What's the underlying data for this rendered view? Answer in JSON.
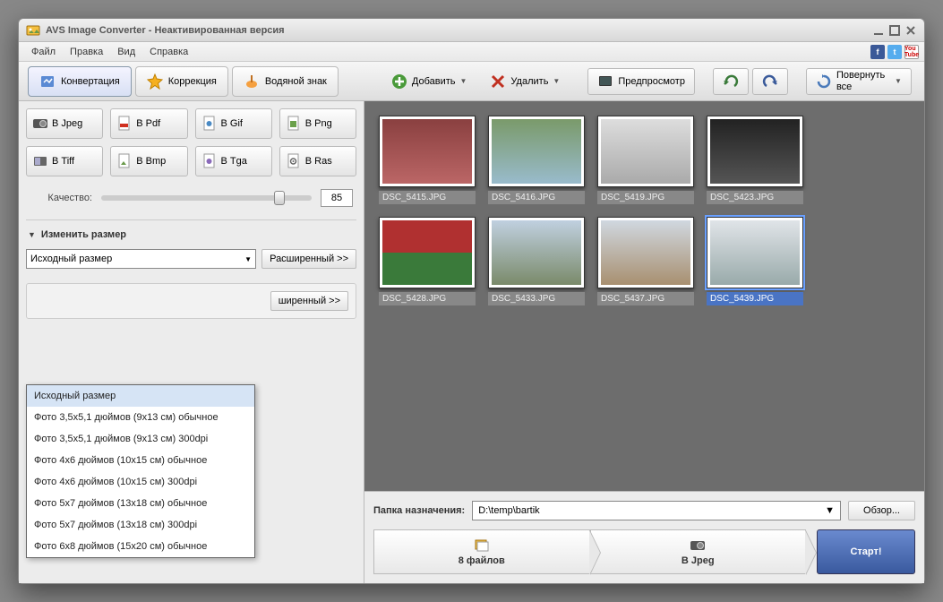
{
  "title": "AVS Image Converter - Неактивированная версия",
  "menu": [
    "Файл",
    "Правка",
    "Вид",
    "Справка"
  ],
  "tabs": {
    "convert": "Конвертация",
    "correct": "Коррекция",
    "watermark": "Водяной знак"
  },
  "toolbar": {
    "add": "Добавить",
    "delete": "Удалить",
    "preview": "Предпросмотр",
    "rotate": "Повернуть все"
  },
  "formats": {
    "jpeg": "В Jpeg",
    "pdf": "В Pdf",
    "gif": "В Gif",
    "png": "В Png",
    "tiff": "В Tiff",
    "bmp": "В Bmp",
    "tga": "В Tga",
    "ras": "В Ras"
  },
  "quality": {
    "label": "Качество:",
    "value": "85"
  },
  "resize": {
    "header": "Изменить размер",
    "selected": "Исходный размер",
    "advanced": "Расширенный >>",
    "options": [
      "Исходный размер",
      "Фото 3,5x5,1 дюймов (9x13 см) обычное",
      "Фото 3,5x5,1 дюймов (9x13 см) 300dpi",
      "Фото 4x6 дюймов (10x15 см) обычное",
      "Фото 4x6 дюймов (10x15 см) 300dpi",
      "Фото 5x7 дюймов (13x18 см) обычное",
      "Фото 5x7 дюймов (13x18 см) 300dpi",
      "Фото 6x8 дюймов (15x20 см) обычное"
    ]
  },
  "hidden_adv": "ширенный >>",
  "thumbs": [
    {
      "name": "DSC_5415.JPG",
      "bg": "linear-gradient(#8a4040,#b66)",
      "sel": false
    },
    {
      "name": "DSC_5416.JPG",
      "bg": "linear-gradient(#7a9a6a,#9bc)",
      "sel": false
    },
    {
      "name": "DSC_5419.JPG",
      "bg": "linear-gradient(#ddd,#aaa)",
      "sel": false
    },
    {
      "name": "DSC_5423.JPG",
      "bg": "linear-gradient(#222,#555)",
      "sel": false
    },
    {
      "name": "DSC_5428.JPG",
      "bg": "linear-gradient(#b03030 50%,#3a7a3a 50%)",
      "sel": false
    },
    {
      "name": "DSC_5433.JPG",
      "bg": "linear-gradient(#c0d0e0,#7a8a6a)",
      "sel": false
    },
    {
      "name": "DSC_5437.JPG",
      "bg": "linear-gradient(#d0d8e0,#a89070)",
      "sel": false
    },
    {
      "name": "DSC_5439.JPG",
      "bg": "linear-gradient(#e0e4e8,#9aa)",
      "sel": true
    }
  ],
  "dest": {
    "label": "Папка назначения:",
    "path": "D:\\temp\\bartik",
    "browse": "Обзор..."
  },
  "steps": {
    "files": "8 файлов",
    "fmt": "В Jpeg"
  },
  "start": "Старт!"
}
